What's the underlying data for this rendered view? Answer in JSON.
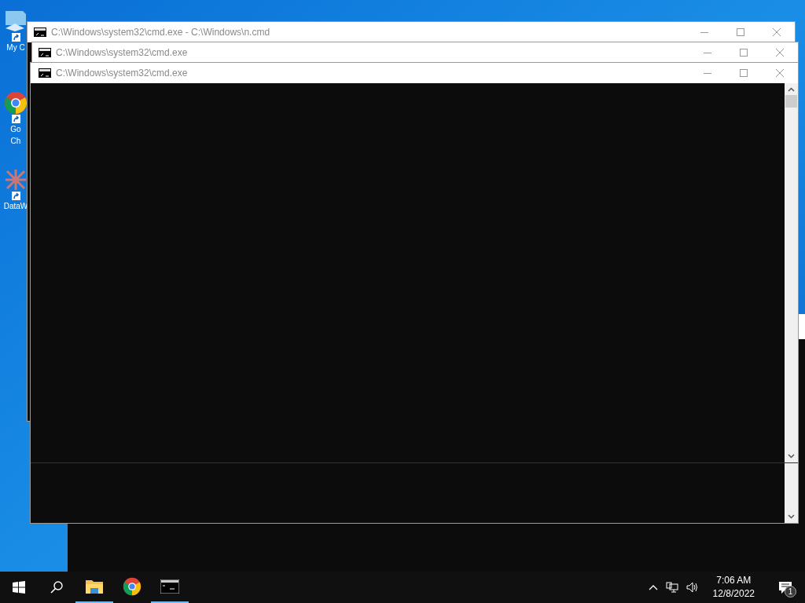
{
  "desktop_icons": [
    {
      "kind": "computer",
      "lines": [
        "My C"
      ]
    },
    {
      "kind": "chrome",
      "lines": [
        "Go",
        "Ch"
      ]
    },
    {
      "kind": "grid",
      "lines": [
        "DataW"
      ]
    }
  ],
  "windows": [
    {
      "title": "C:\\Windows\\system32\\cmd.exe - C:\\Windows\\n.cmd"
    },
    {
      "title": "C:\\Windows\\system32\\cmd.exe"
    },
    {
      "title": "C:\\Windows\\system32\\cmd.exe"
    }
  ],
  "taskbar": {
    "apps": [
      {
        "kind": "explorer",
        "running": true
      },
      {
        "kind": "chrome",
        "running": false
      },
      {
        "kind": "cmd",
        "running": true
      }
    ],
    "time": "7:06 AM",
    "date": "12/8/2022",
    "notifications": "1"
  }
}
